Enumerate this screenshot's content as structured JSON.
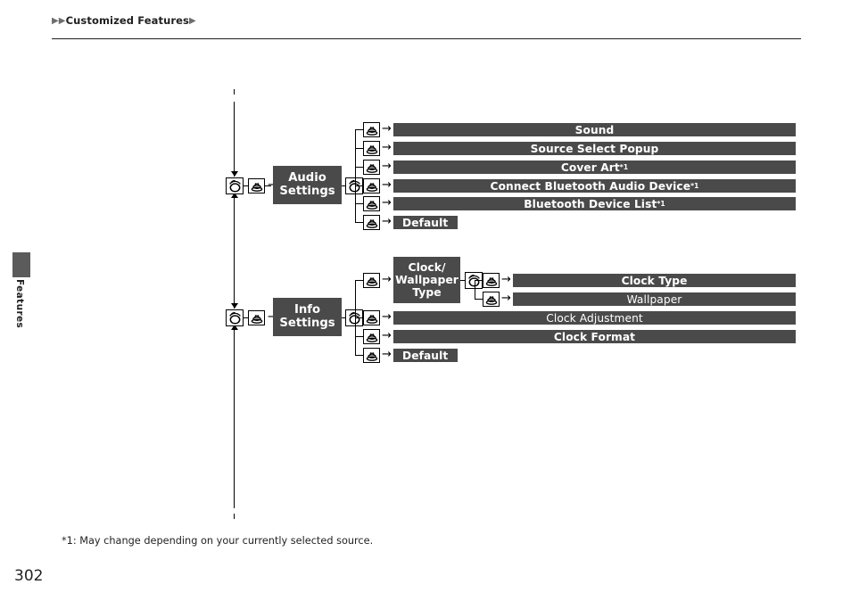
{
  "header": {
    "breadcrumb_text": "Customized Features",
    "arrow_glyph": "▶"
  },
  "side_tab": {
    "label": "Features"
  },
  "page": {
    "number": "302",
    "footnote": "*1: May change depending on your currently selected source."
  },
  "colors": {
    "bar_fill": "#4a4a4a",
    "node_fill": "#4a4a4a",
    "text_on_dark": "#ffffff",
    "line": "#000000",
    "tab_block": "#5b5b5b",
    "body_text": "#231f20"
  },
  "icons": {
    "knob": "rotary-knob-icon",
    "button": "press-button-icon",
    "arrow": "→"
  },
  "diagram": {
    "groups": [
      {
        "id": "audio-settings",
        "node_label_lines": [
          "Audio",
          "Settings"
        ],
        "items": [
          {
            "label": "Sound",
            "footnote": "",
            "style": "bold",
            "width": "full"
          },
          {
            "label": "Source Select Popup",
            "footnote": "",
            "style": "bold",
            "width": "full"
          },
          {
            "label": "Cover Art",
            "footnote": "*1",
            "style": "bold",
            "width": "full"
          },
          {
            "label": "Connect Bluetooth Audio Device",
            "footnote": "*1",
            "style": "bold",
            "width": "full"
          },
          {
            "label": "Bluetooth Device List",
            "footnote": "*1",
            "style": "bold",
            "width": "full"
          },
          {
            "label": "Default",
            "footnote": "",
            "style": "bold",
            "width": "short"
          }
        ]
      },
      {
        "id": "info-settings",
        "node_label_lines": [
          "Info",
          "Settings"
        ],
        "items": [
          {
            "label": "Clock/ Wallpaper Type",
            "footnote": "",
            "style": "bold",
            "width": "node"
          },
          {
            "label": "Clock Adjustment",
            "footnote": "",
            "style": "reg",
            "width": "full"
          },
          {
            "label": "Clock Format",
            "footnote": "",
            "style": "bold",
            "width": "full"
          },
          {
            "label": "Default",
            "footnote": "",
            "style": "bold",
            "width": "short"
          }
        ],
        "sub_node": {
          "label_lines": [
            "Clock/",
            "Wallpaper",
            "Type"
          ],
          "items": [
            {
              "label": "Clock Type",
              "footnote": "",
              "style": "bold",
              "width": "sub"
            },
            {
              "label": "Wallpaper",
              "footnote": "",
              "style": "reg",
              "width": "sub"
            }
          ]
        }
      }
    ]
  }
}
